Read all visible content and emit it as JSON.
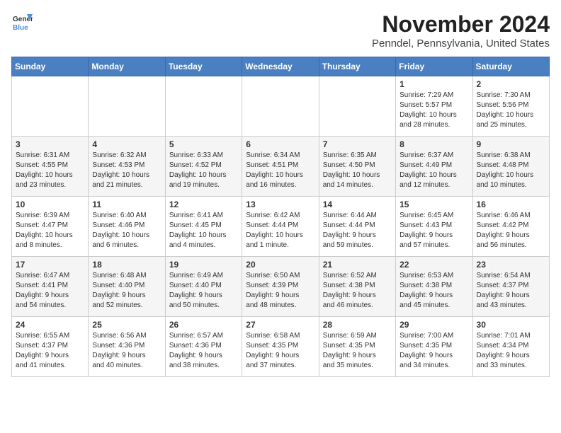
{
  "header": {
    "logo_general": "General",
    "logo_blue": "Blue",
    "month": "November 2024",
    "location": "Penndel, Pennsylvania, United States"
  },
  "weekdays": [
    "Sunday",
    "Monday",
    "Tuesday",
    "Wednesday",
    "Thursday",
    "Friday",
    "Saturday"
  ],
  "weeks": [
    [
      {
        "day": "",
        "info": ""
      },
      {
        "day": "",
        "info": ""
      },
      {
        "day": "",
        "info": ""
      },
      {
        "day": "",
        "info": ""
      },
      {
        "day": "",
        "info": ""
      },
      {
        "day": "1",
        "info": "Sunrise: 7:29 AM\nSunset: 5:57 PM\nDaylight: 10 hours\nand 28 minutes."
      },
      {
        "day": "2",
        "info": "Sunrise: 7:30 AM\nSunset: 5:56 PM\nDaylight: 10 hours\nand 25 minutes."
      }
    ],
    [
      {
        "day": "3",
        "info": "Sunrise: 6:31 AM\nSunset: 4:55 PM\nDaylight: 10 hours\nand 23 minutes."
      },
      {
        "day": "4",
        "info": "Sunrise: 6:32 AM\nSunset: 4:53 PM\nDaylight: 10 hours\nand 21 minutes."
      },
      {
        "day": "5",
        "info": "Sunrise: 6:33 AM\nSunset: 4:52 PM\nDaylight: 10 hours\nand 19 minutes."
      },
      {
        "day": "6",
        "info": "Sunrise: 6:34 AM\nSunset: 4:51 PM\nDaylight: 10 hours\nand 16 minutes."
      },
      {
        "day": "7",
        "info": "Sunrise: 6:35 AM\nSunset: 4:50 PM\nDaylight: 10 hours\nand 14 minutes."
      },
      {
        "day": "8",
        "info": "Sunrise: 6:37 AM\nSunset: 4:49 PM\nDaylight: 10 hours\nand 12 minutes."
      },
      {
        "day": "9",
        "info": "Sunrise: 6:38 AM\nSunset: 4:48 PM\nDaylight: 10 hours\nand 10 minutes."
      }
    ],
    [
      {
        "day": "10",
        "info": "Sunrise: 6:39 AM\nSunset: 4:47 PM\nDaylight: 10 hours\nand 8 minutes."
      },
      {
        "day": "11",
        "info": "Sunrise: 6:40 AM\nSunset: 4:46 PM\nDaylight: 10 hours\nand 6 minutes."
      },
      {
        "day": "12",
        "info": "Sunrise: 6:41 AM\nSunset: 4:45 PM\nDaylight: 10 hours\nand 4 minutes."
      },
      {
        "day": "13",
        "info": "Sunrise: 6:42 AM\nSunset: 4:44 PM\nDaylight: 10 hours\nand 1 minute."
      },
      {
        "day": "14",
        "info": "Sunrise: 6:44 AM\nSunset: 4:44 PM\nDaylight: 9 hours\nand 59 minutes."
      },
      {
        "day": "15",
        "info": "Sunrise: 6:45 AM\nSunset: 4:43 PM\nDaylight: 9 hours\nand 57 minutes."
      },
      {
        "day": "16",
        "info": "Sunrise: 6:46 AM\nSunset: 4:42 PM\nDaylight: 9 hours\nand 56 minutes."
      }
    ],
    [
      {
        "day": "17",
        "info": "Sunrise: 6:47 AM\nSunset: 4:41 PM\nDaylight: 9 hours\nand 54 minutes."
      },
      {
        "day": "18",
        "info": "Sunrise: 6:48 AM\nSunset: 4:40 PM\nDaylight: 9 hours\nand 52 minutes."
      },
      {
        "day": "19",
        "info": "Sunrise: 6:49 AM\nSunset: 4:40 PM\nDaylight: 9 hours\nand 50 minutes."
      },
      {
        "day": "20",
        "info": "Sunrise: 6:50 AM\nSunset: 4:39 PM\nDaylight: 9 hours\nand 48 minutes."
      },
      {
        "day": "21",
        "info": "Sunrise: 6:52 AM\nSunset: 4:38 PM\nDaylight: 9 hours\nand 46 minutes."
      },
      {
        "day": "22",
        "info": "Sunrise: 6:53 AM\nSunset: 4:38 PM\nDaylight: 9 hours\nand 45 minutes."
      },
      {
        "day": "23",
        "info": "Sunrise: 6:54 AM\nSunset: 4:37 PM\nDaylight: 9 hours\nand 43 minutes."
      }
    ],
    [
      {
        "day": "24",
        "info": "Sunrise: 6:55 AM\nSunset: 4:37 PM\nDaylight: 9 hours\nand 41 minutes."
      },
      {
        "day": "25",
        "info": "Sunrise: 6:56 AM\nSunset: 4:36 PM\nDaylight: 9 hours\nand 40 minutes."
      },
      {
        "day": "26",
        "info": "Sunrise: 6:57 AM\nSunset: 4:36 PM\nDaylight: 9 hours\nand 38 minutes."
      },
      {
        "day": "27",
        "info": "Sunrise: 6:58 AM\nSunset: 4:35 PM\nDaylight: 9 hours\nand 37 minutes."
      },
      {
        "day": "28",
        "info": "Sunrise: 6:59 AM\nSunset: 4:35 PM\nDaylight: 9 hours\nand 35 minutes."
      },
      {
        "day": "29",
        "info": "Sunrise: 7:00 AM\nSunset: 4:35 PM\nDaylight: 9 hours\nand 34 minutes."
      },
      {
        "day": "30",
        "info": "Sunrise: 7:01 AM\nSunset: 4:34 PM\nDaylight: 9 hours\nand 33 minutes."
      }
    ]
  ]
}
